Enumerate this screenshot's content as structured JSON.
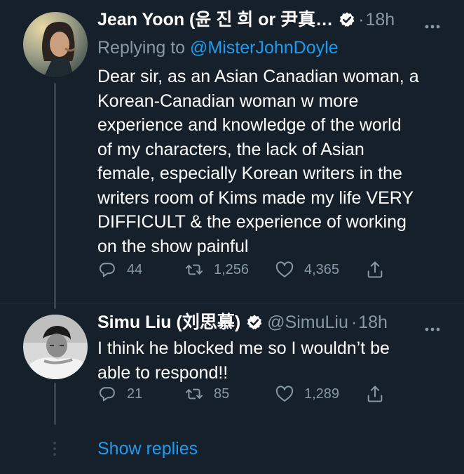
{
  "colors": {
    "background": "#15202b",
    "text": "#ffffff",
    "secondary": "#8899a6",
    "accent": "#1d9bf0",
    "thread_line": "#38444d"
  },
  "tweets": [
    {
      "name": "Jean Yoon (윤 진 희 or 尹真…",
      "handle": "",
      "dot": "·",
      "time": "18h",
      "replying_prefix": "Replying to",
      "replying_handle": "@MisterJohnDoyle",
      "lines": [
        "Dear sir, as an Asian Canadian woman, a",
        "Korean-Canadian woman w more",
        "experience and knowledge of the world",
        "of my characters, the lack of Asian",
        "female, especially Korean writers in the",
        "writers room of Kims made my life VERY",
        "DIFFICULT & the experience of working",
        "on the show painful"
      ],
      "replies": "44",
      "retweets": "1,256",
      "likes": "4,365",
      "icons": [
        "avatar",
        "verified-badge-icon",
        "more-icon",
        "reply-icon",
        "retweet-icon",
        "like-icon",
        "share-icon"
      ]
    },
    {
      "name": "Simu Liu (刘思慕)",
      "handle": "@SimuLiu",
      "dot": "·",
      "time": "18h",
      "lines": [
        "I think he blocked me so I wouldn’t be",
        "able to respond!!"
      ],
      "replies": "21",
      "retweets": "85",
      "likes": "1,289",
      "icons": [
        "avatar",
        "verified-badge-icon",
        "more-icon",
        "reply-icon",
        "retweet-icon",
        "like-icon",
        "share-icon"
      ]
    }
  ],
  "show_replies_label": "Show replies"
}
